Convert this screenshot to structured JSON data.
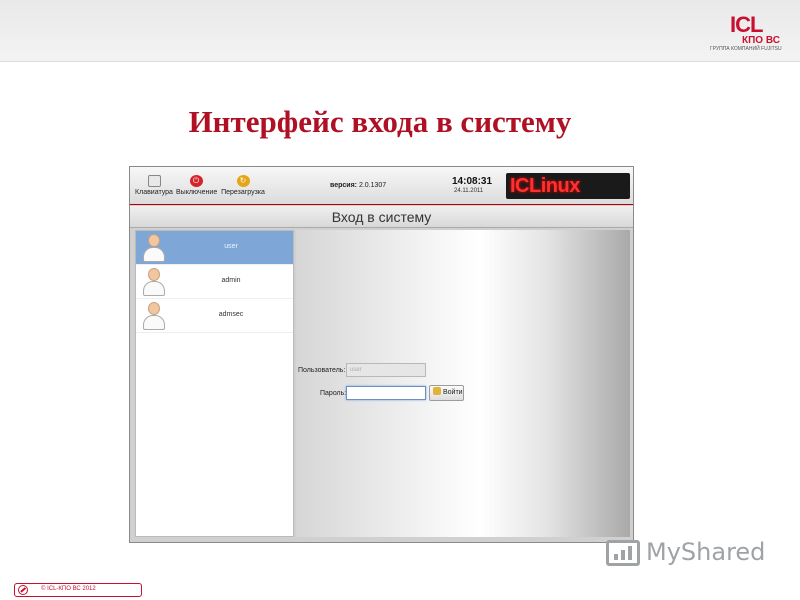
{
  "slide": {
    "title": "Интерфейс входа в систему",
    "footer_text": "© ICL-КПО ВС 2012",
    "watermark": "MyShared"
  },
  "logo": {
    "main": "ICL",
    "sub": "КПО ВС",
    "group": "ГРУППА КОМПАНИЙ FUJITSU"
  },
  "screen": {
    "toolbar": {
      "keyboard_label": "Клавиатура",
      "shutdown_label": "Выключение",
      "reboot_label": "Перезагрузка"
    },
    "version_label": "версия:",
    "version_value": "2.0.1307",
    "time": "14:08:31",
    "date": "24.11.2011",
    "brand": "ICLinux",
    "login_title": "Вход в систему",
    "users": [
      {
        "name": "user",
        "selected": true
      },
      {
        "name": "admin",
        "selected": false
      },
      {
        "name": "admsec",
        "selected": false
      }
    ],
    "form": {
      "user_label": "Пользователь:",
      "user_value": "user",
      "password_label": "Пароль:",
      "password_value": "",
      "login_button": "Войти"
    }
  },
  "colors": {
    "accent": "#c8102e",
    "selection": "#7ea7d8"
  },
  "icons": [
    "keyboard-icon",
    "power-icon",
    "reboot-icon",
    "lock-icon",
    "user-avatar-icon",
    "no-entry-icon",
    "myshared-logo-icon"
  ]
}
